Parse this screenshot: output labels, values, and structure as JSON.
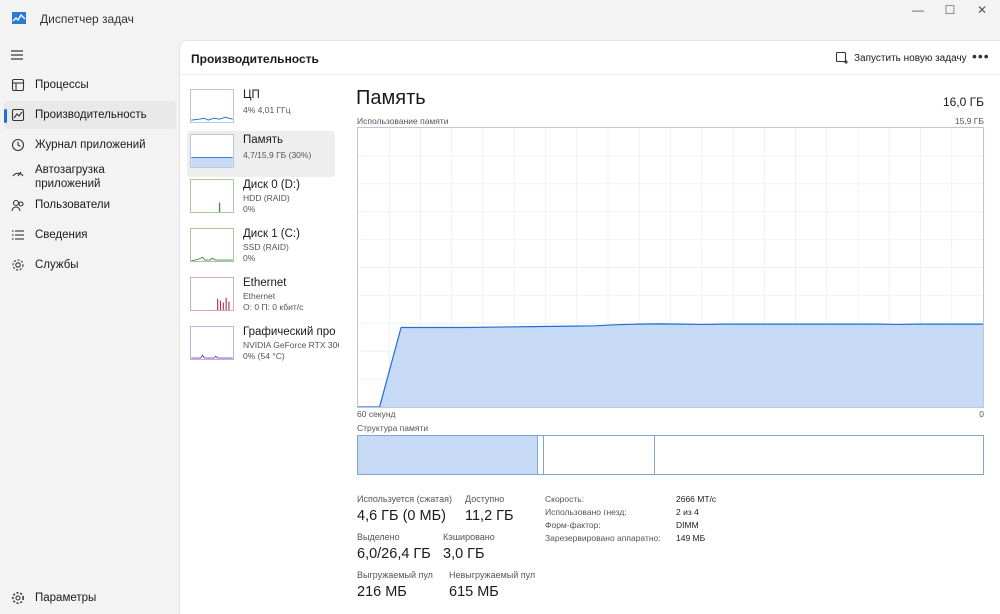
{
  "app": {
    "title": "Диспетчер задач",
    "accent": "#1e6fd6"
  },
  "window": {
    "minimize": "—",
    "maximize": "☐",
    "close": "✕"
  },
  "sidebar": {
    "items": [
      {
        "label": "Процессы",
        "icon": "processes-icon"
      },
      {
        "label": "Производительность",
        "icon": "performance-icon",
        "active": true
      },
      {
        "label": "Журнал приложений",
        "icon": "app-history-icon"
      },
      {
        "label": "Автозагрузка\nприложений",
        "icon": "startup-icon"
      },
      {
        "label": "Пользователи",
        "icon": "users-icon"
      },
      {
        "label": "Сведения",
        "icon": "details-icon"
      },
      {
        "label": "Службы",
        "icon": "services-icon"
      }
    ],
    "settings": "Параметры"
  },
  "header": {
    "title": "Производительность",
    "run_task": "Запустить новую задачу",
    "more": "•••"
  },
  "devices": [
    {
      "name": "ЦП",
      "line1": "4% 4,01 ГГц",
      "line2": ""
    },
    {
      "name": "Память",
      "line1": "4,7/15,9 ГБ (30%)",
      "line2": ""
    },
    {
      "name": "Диск 0 (D:)",
      "line1": "HDD (RAID)",
      "line2": "0%"
    },
    {
      "name": "Диск 1 (C:)",
      "line1": "SSD (RAID)",
      "line2": "0%"
    },
    {
      "name": "Ethernet",
      "line1": "Ethernet",
      "line2": "О: 0 П: 0 кбит/с"
    },
    {
      "name": "Графический про",
      "line1": "NVIDIA GeForce RTX 30€",
      "line2": "0% (54 °C)"
    }
  ],
  "memory": {
    "title": "Память",
    "total": "16,0 ГБ",
    "usage_label": "Использование памяти",
    "usage_max": "15,9 ГБ",
    "axis_left": "60 секунд",
    "axis_right": "0",
    "usage_history_fraction": [
      0,
      0,
      0.285,
      0.285,
      0.285,
      0.285,
      0.286,
      0.287,
      0.288,
      0.289,
      0.29,
      0.291,
      0.295,
      0.297,
      0.298,
      0.297,
      0.296,
      0.297,
      0.297,
      0.297,
      0.297,
      0.297,
      0.297,
      0.297,
      0.297,
      0.296,
      0.297,
      0.297,
      0.297,
      0.297
    ],
    "structure_label": "Структура памяти",
    "structure": {
      "in_use": 0.288,
      "modified": 0.009,
      "standby": 0.178,
      "free": 0.525
    },
    "stats": {
      "in_use_label": "Используется (сжатая)",
      "in_use_value": "4,6 ГБ (0 МБ)",
      "available_label": "Доступно",
      "available_value": "11,2 ГБ",
      "committed_label": "Выделено",
      "committed_value": "6,0/26,4 ГБ",
      "cached_label": "Кэшировано",
      "cached_value": "3,0 ГБ",
      "paged_label": "Выгружаемый пул",
      "paged_value": "216 МБ",
      "nonpaged_label": "Невыгружаемый пул",
      "nonpaged_value": "615 МБ"
    },
    "specs": {
      "speed_label": "Скорость:",
      "speed_value": "2666 MT/c",
      "slots_label": "Использовано гнезд:",
      "slots_value": "2 из 4",
      "form_label": "Форм-фактор:",
      "form_value": "DIMM",
      "reserved_label": "Зарезервировано аппаратно:",
      "reserved_value": "149 МБ"
    }
  }
}
